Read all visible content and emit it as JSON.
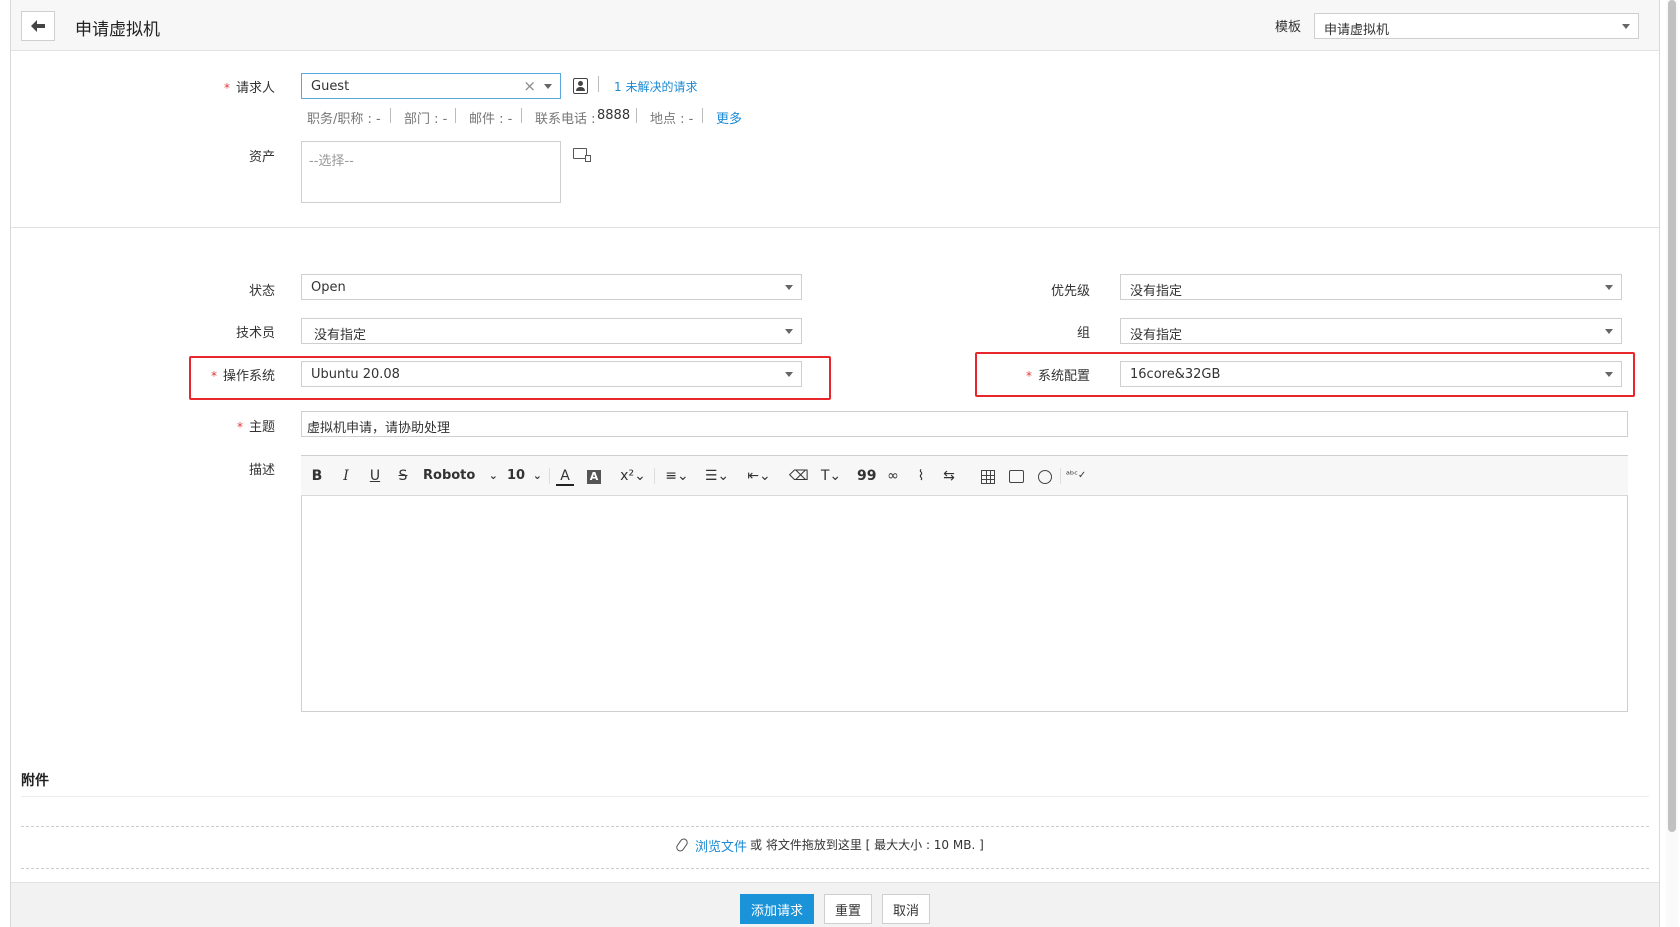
{
  "header": {
    "title": "申请虚拟机",
    "template_label": "模板",
    "template_value": "申请虚拟机"
  },
  "requester": {
    "label": "请求人",
    "value": "Guest",
    "clear": "×",
    "open_requests": "1 未解决的请求",
    "meta": {
      "job": "职务/职称 : -",
      "dept": "部门 : -",
      "email": "邮件 : -",
      "phone_label": "联系电话 :",
      "phone_value": "8888",
      "location": "地点 : -",
      "more": "更多"
    }
  },
  "asset": {
    "label": "资产",
    "placeholder": "--选择--"
  },
  "fields": {
    "status_label": "状态",
    "status_value": "Open",
    "priority_label": "优先级",
    "priority_value": "没有指定",
    "tech_label": "技术员",
    "tech_value": "没有指定",
    "group_label": "组",
    "group_value": "没有指定",
    "os_label": "操作系统",
    "os_value": "Ubuntu 20.08",
    "config_label": "系统配置",
    "config_value": "16core&32GB",
    "subject_label": "主题",
    "subject_value": "虚拟机申请，请协助处理",
    "desc_label": "描述"
  },
  "editor": {
    "font_name": "Roboto",
    "font_size": "10"
  },
  "attachments": {
    "title": "附件",
    "browse": "浏览文件",
    "drop_text": "或 将文件拖放到这里 [ 最大大小 : 10 MB. ]"
  },
  "actions": {
    "add": "添加请求",
    "reset": "重置",
    "cancel": "取消"
  },
  "colors": {
    "accent": "#1a93d9",
    "link": "#1b8ad3",
    "required": "#e4393c",
    "highlight_box": "#e8262b"
  }
}
